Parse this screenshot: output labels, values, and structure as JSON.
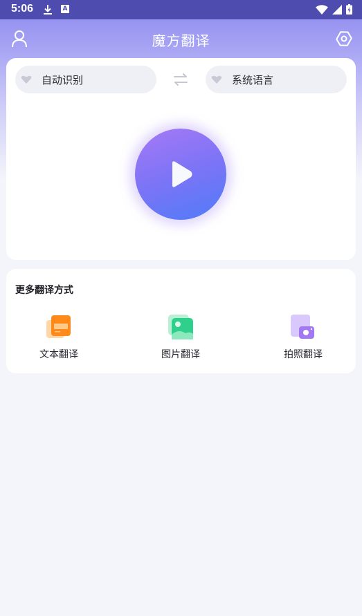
{
  "status_bar": {
    "time": "5:06"
  },
  "header": {
    "title": "魔方翻译"
  },
  "languages": {
    "source": "自动识别",
    "target": "系统语言"
  },
  "more": {
    "title": "更多翻译方式",
    "tools": [
      {
        "label": "文本翻译",
        "icon": "text-translate-icon"
      },
      {
        "label": "图片翻译",
        "icon": "image-translate-icon"
      },
      {
        "label": "拍照翻译",
        "icon": "camera-translate-icon"
      }
    ]
  },
  "colors": {
    "status_bar": "#4e4cae",
    "header_gradient_top": "#8c88ee",
    "background": "#f4f5fa",
    "play_gradient_start": "#a679f5",
    "play_gradient_end": "#4f7cf8",
    "text_tool_orange": "#ff8a1a",
    "image_tool_green": "#2fcf8c",
    "camera_tool_purple": "#a278f3"
  }
}
